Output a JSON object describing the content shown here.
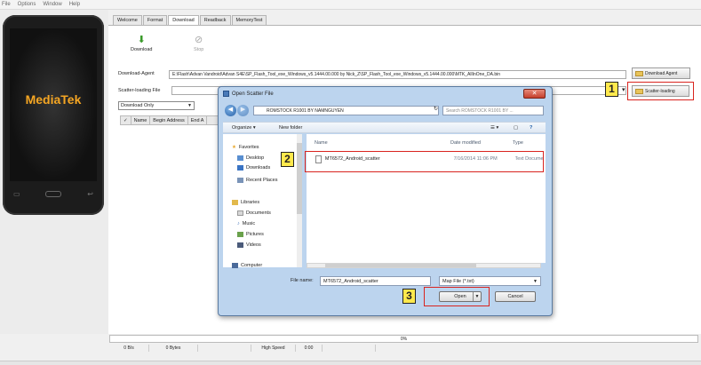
{
  "menu": [
    "File",
    "Options",
    "Window",
    "Help"
  ],
  "brand": "MediaTek",
  "tabs": [
    "Welcome",
    "Format",
    "Download",
    "Readback",
    "MemoryTest"
  ],
  "active_tab": "Download",
  "toolbar": {
    "download": "Download",
    "stop": "Stop"
  },
  "download_agent": {
    "label": "Download-Agent",
    "path": "E:\\Flash\\Advan Vandroid\\Advan S4E\\SP_Flash_Tool_exe_Windows_v5.1444.00.000 by Nick_Z\\SP_Flash_Tool_exe_Windows_v5.1444.00.000\\MTK_AllInOne_DA.bin",
    "button": "Download Agent"
  },
  "scatter": {
    "label": "Scatter-loading File",
    "button": "Scatter-loading"
  },
  "mode_dropdown": "Download Only",
  "grid_columns": [
    "✓",
    "Name",
    "Begin Address",
    "End A"
  ],
  "dialog": {
    "title": "Open Scatter File",
    "address": "ROMSTOCK R1001 BY NAMNGUYEN",
    "search_placeholder": "Search ROMSTOCK R1001 BY ...",
    "organize": "Organize ▾",
    "new_folder": "New folder",
    "favorites": "Favorites",
    "desktop": "Desktop",
    "downloads": "Downloads",
    "recent": "Recent Places",
    "libraries": "Libraries",
    "documents": "Documents",
    "music": "Music",
    "pictures": "Pictures",
    "videos": "Videos",
    "computer": "Computer",
    "col_name": "Name",
    "col_date": "Date modified",
    "col_type": "Type",
    "file": {
      "name": "MT6572_Android_scatter",
      "date": "7/16/2014 11:06 PM",
      "type": "Text Document"
    },
    "filename_label": "File name:",
    "filename_value": "MT6572_Android_scatter",
    "filetype": "Map File (*.txt)",
    "open": "Open",
    "cancel": "Cancel"
  },
  "callouts": [
    "1",
    "2",
    "3"
  ],
  "progress": {
    "text": "0%",
    "value": 0
  },
  "status": [
    "0 B/s",
    "0 Bytes",
    "",
    "High Speed",
    "0:00",
    ""
  ]
}
